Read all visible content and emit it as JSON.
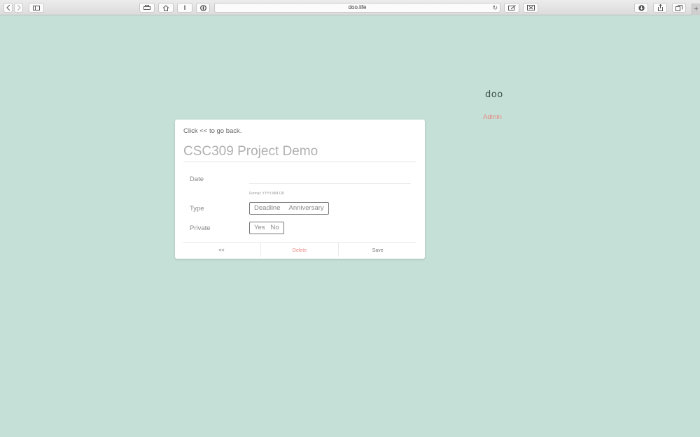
{
  "browser": {
    "url": "doo.life",
    "new_tab_glyph": "+"
  },
  "site": {
    "logo": "doo",
    "admin_link": "Admin"
  },
  "card": {
    "hint": "Click << to go back.",
    "title": "CSC309 Project Demo",
    "date_label": "Date",
    "date_format": "Format: YYYY-MM-DD",
    "type_label": "Type",
    "type_options": [
      "Deadline",
      "Anniversary"
    ],
    "private_label": "Private",
    "private_options": [
      "Yes",
      "No"
    ],
    "back_button": "<<",
    "delete_button": "Delete",
    "save_button": "Save"
  },
  "colors": {
    "background": "#c4e0d7",
    "accent": "#e98a82"
  }
}
